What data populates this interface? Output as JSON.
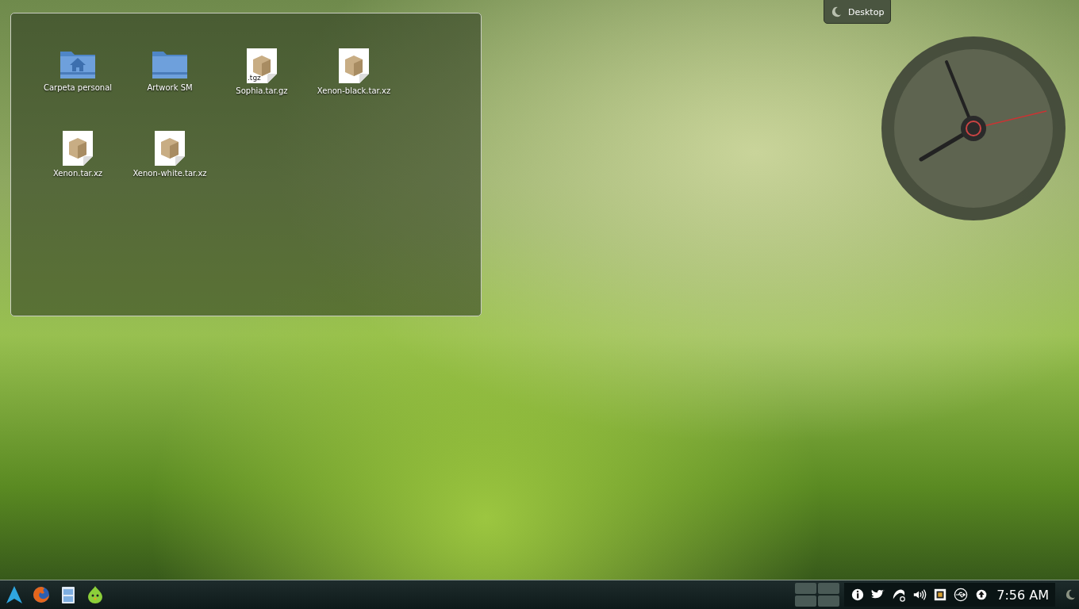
{
  "desktop_toolbox": {
    "label": "Desktop"
  },
  "folder_view": {
    "items": [
      {
        "name": "Carpeta personal",
        "kind": "home-folder"
      },
      {
        "name": "Artwork SM",
        "kind": "folder"
      },
      {
        "name": "Sophia.tar.gz",
        "kind": "archive",
        "badge": ".tgz"
      },
      {
        "name": "Xenon-black.tar.xz",
        "kind": "archive"
      },
      {
        "name": "Xenon.tar.xz",
        "kind": "archive"
      },
      {
        "name": "Xenon-white.tar.xz",
        "kind": "archive"
      }
    ]
  },
  "panel": {
    "launchers": [
      {
        "kind": "menu"
      },
      {
        "kind": "browser"
      },
      {
        "kind": "files"
      },
      {
        "kind": "chat"
      }
    ],
    "tray": [
      {
        "kind": "info"
      },
      {
        "kind": "bird"
      },
      {
        "kind": "updater"
      },
      {
        "kind": "volume"
      },
      {
        "kind": "network"
      },
      {
        "kind": "usb"
      },
      {
        "kind": "arrow-up"
      }
    ],
    "clock": "7:56 AM"
  }
}
